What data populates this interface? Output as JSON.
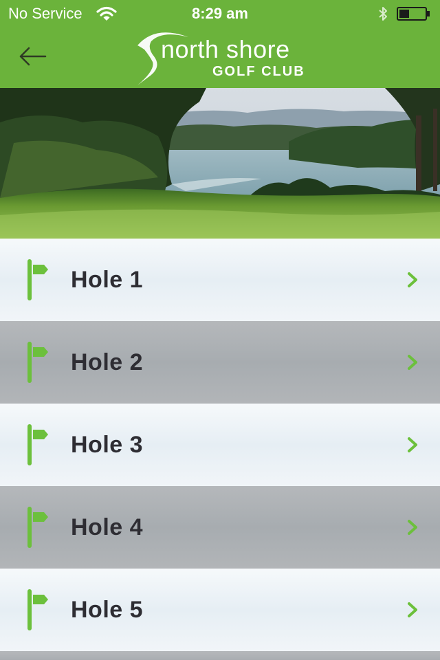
{
  "status_bar": {
    "carrier": "No Service",
    "time": "8:29 am",
    "icons": [
      "wifi-icon",
      "bluetooth-icon",
      "battery-icon"
    ]
  },
  "header": {
    "back_icon": "arrow-left-icon",
    "logo": {
      "main": "north shore",
      "sub": "GOLF CLUB"
    }
  },
  "hero": {
    "description_icon": "golf-course-image"
  },
  "holes": [
    {
      "label": "Hole 1",
      "icon": "flag-icon",
      "chevron": "chevron-right-icon"
    },
    {
      "label": "Hole 2",
      "icon": "flag-icon",
      "chevron": "chevron-right-icon"
    },
    {
      "label": "Hole 3",
      "icon": "flag-icon",
      "chevron": "chevron-right-icon"
    },
    {
      "label": "Hole 4",
      "icon": "flag-icon",
      "chevron": "chevron-right-icon"
    },
    {
      "label": "Hole 5",
      "icon": "flag-icon",
      "chevron": "chevron-right-icon"
    }
  ],
  "colors": {
    "brand_green": "#6bb33b",
    "icon_green": "#6cc03c",
    "text_dark": "#2e2d33",
    "row_light": "#eaf1f5",
    "row_dark": "#aeb2b5"
  }
}
